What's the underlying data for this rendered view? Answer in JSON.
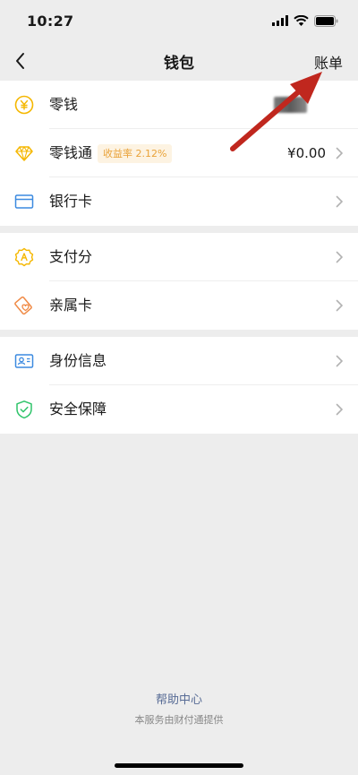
{
  "status_bar": {
    "time": "10:27"
  },
  "nav": {
    "title": "钱包",
    "right_label": "账单"
  },
  "group1": [
    {
      "name": "change",
      "label": "零钱",
      "value_hidden": true
    },
    {
      "name": "lingqiantong",
      "label": "零钱通",
      "badge": "收益率 2.12%",
      "value": "¥0.00"
    },
    {
      "name": "bank-card",
      "label": "银行卡"
    }
  ],
  "group2": [
    {
      "name": "payment-score",
      "label": "支付分"
    },
    {
      "name": "family-card",
      "label": "亲属卡"
    }
  ],
  "group3": [
    {
      "name": "identity-info",
      "label": "身份信息"
    },
    {
      "name": "security",
      "label": "安全保障"
    }
  ],
  "footer": {
    "help": "帮助中心",
    "provider": "本服务由财付通提供"
  },
  "colors": {
    "accent_yellow": "#f5b700",
    "accent_orange": "#f08a45",
    "accent_blue": "#3c8ae0",
    "accent_green": "#2fc46a",
    "link": "#576b95",
    "arrow": "#c0271e"
  }
}
